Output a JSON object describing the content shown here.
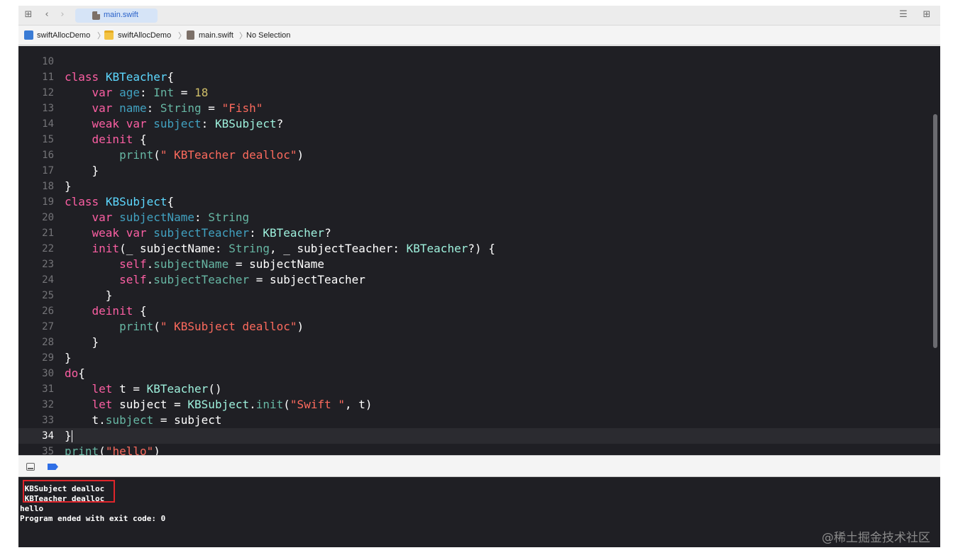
{
  "tab": {
    "title": "main.swift"
  },
  "breadcrumb": {
    "project": "swiftAllocDemo",
    "folder": "swiftAllocDemo",
    "file": "main.swift",
    "selection": "No Selection"
  },
  "editor": {
    "current_line": 34,
    "lines": [
      {
        "n": "10",
        "tokens": []
      },
      {
        "n": "11",
        "tokens": [
          [
            "kw",
            "class"
          ],
          [
            "pl",
            " "
          ],
          [
            "ty",
            "KBTeacher"
          ],
          [
            "pl",
            "{"
          ]
        ]
      },
      {
        "n": "12",
        "tokens": [
          [
            "pl",
            "    "
          ],
          [
            "kw",
            "var"
          ],
          [
            "pl",
            " "
          ],
          [
            "id",
            "age"
          ],
          [
            "pl",
            ": "
          ],
          [
            "ty2",
            "Int"
          ],
          [
            "pl",
            " = "
          ],
          [
            "nm",
            "18"
          ]
        ]
      },
      {
        "n": "13",
        "tokens": [
          [
            "pl",
            "    "
          ],
          [
            "kw",
            "var"
          ],
          [
            "pl",
            " "
          ],
          [
            "id",
            "name"
          ],
          [
            "pl",
            ": "
          ],
          [
            "ty2",
            "String"
          ],
          [
            "pl",
            " = "
          ],
          [
            "st",
            "\"Fish\""
          ]
        ]
      },
      {
        "n": "14",
        "tokens": [
          [
            "pl",
            "    "
          ],
          [
            "kw",
            "weak var"
          ],
          [
            "pl",
            " "
          ],
          [
            "id",
            "subject"
          ],
          [
            "pl",
            ": "
          ],
          [
            "cl",
            "KBSubject"
          ],
          [
            "pl",
            "?"
          ]
        ]
      },
      {
        "n": "15",
        "tokens": [
          [
            "pl",
            "    "
          ],
          [
            "kw",
            "deinit"
          ],
          [
            "pl",
            " {"
          ]
        ]
      },
      {
        "n": "16",
        "tokens": [
          [
            "pl",
            "        "
          ],
          [
            "pr",
            "print"
          ],
          [
            "pl",
            "("
          ],
          [
            "st",
            "\" KBTeacher dealloc\""
          ],
          [
            "pl",
            ")"
          ]
        ]
      },
      {
        "n": "17",
        "tokens": [
          [
            "pl",
            "    }"
          ]
        ]
      },
      {
        "n": "18",
        "tokens": [
          [
            "pl",
            "}"
          ]
        ]
      },
      {
        "n": "19",
        "tokens": [
          [
            "kw",
            "class"
          ],
          [
            "pl",
            " "
          ],
          [
            "ty",
            "KBSubject"
          ],
          [
            "pl",
            "{"
          ]
        ]
      },
      {
        "n": "20",
        "tokens": [
          [
            "pl",
            "    "
          ],
          [
            "kw",
            "var"
          ],
          [
            "pl",
            " "
          ],
          [
            "id",
            "subjectName"
          ],
          [
            "pl",
            ": "
          ],
          [
            "ty2",
            "String"
          ]
        ]
      },
      {
        "n": "21",
        "tokens": [
          [
            "pl",
            "    "
          ],
          [
            "kw",
            "weak var"
          ],
          [
            "pl",
            " "
          ],
          [
            "id",
            "subjectTeacher"
          ],
          [
            "pl",
            ": "
          ],
          [
            "cl",
            "KBTeacher"
          ],
          [
            "pl",
            "?"
          ]
        ]
      },
      {
        "n": "22",
        "tokens": [
          [
            "pl",
            "    "
          ],
          [
            "kw",
            "init"
          ],
          [
            "pl",
            "(_ subjectName: "
          ],
          [
            "ty2",
            "String"
          ],
          [
            "pl",
            ", _ subjectTeacher: "
          ],
          [
            "cl",
            "KBTeacher"
          ],
          [
            "pl",
            "?) {"
          ]
        ]
      },
      {
        "n": "23",
        "tokens": [
          [
            "pl",
            "        "
          ],
          [
            "kw",
            "self"
          ],
          [
            "pl",
            "."
          ],
          [
            "pr",
            "subjectName"
          ],
          [
            "pl",
            " = subjectName"
          ]
        ]
      },
      {
        "n": "24",
        "tokens": [
          [
            "pl",
            "        "
          ],
          [
            "kw",
            "self"
          ],
          [
            "pl",
            "."
          ],
          [
            "pr",
            "subjectTeacher"
          ],
          [
            "pl",
            " = subjectTeacher"
          ]
        ]
      },
      {
        "n": "25",
        "tokens": [
          [
            "pl",
            "      }"
          ]
        ]
      },
      {
        "n": "26",
        "tokens": [
          [
            "pl",
            "    "
          ],
          [
            "kw",
            "deinit"
          ],
          [
            "pl",
            " {"
          ]
        ]
      },
      {
        "n": "27",
        "tokens": [
          [
            "pl",
            "        "
          ],
          [
            "pr",
            "print"
          ],
          [
            "pl",
            "("
          ],
          [
            "st",
            "\" KBSubject dealloc\""
          ],
          [
            "pl",
            ")"
          ]
        ]
      },
      {
        "n": "28",
        "tokens": [
          [
            "pl",
            "    }"
          ]
        ]
      },
      {
        "n": "29",
        "tokens": [
          [
            "pl",
            "}"
          ]
        ]
      },
      {
        "n": "30",
        "tokens": [
          [
            "kw",
            "do"
          ],
          [
            "pl",
            "{"
          ]
        ]
      },
      {
        "n": "31",
        "tokens": [
          [
            "pl",
            "    "
          ],
          [
            "kw",
            "let"
          ],
          [
            "pl",
            " t = "
          ],
          [
            "cl",
            "KBTeacher"
          ],
          [
            "pl",
            "()"
          ]
        ]
      },
      {
        "n": "32",
        "tokens": [
          [
            "pl",
            "    "
          ],
          [
            "kw",
            "let"
          ],
          [
            "pl",
            " subject = "
          ],
          [
            "cl",
            "KBSubject"
          ],
          [
            "pl",
            "."
          ],
          [
            "pr",
            "init"
          ],
          [
            "pl",
            "("
          ],
          [
            "st",
            "\"Swift \""
          ],
          [
            "pl",
            ", t)"
          ]
        ]
      },
      {
        "n": "33",
        "tokens": [
          [
            "pl",
            "    t."
          ],
          [
            "pr",
            "subject"
          ],
          [
            "pl",
            " = subject"
          ]
        ]
      },
      {
        "n": "34",
        "tokens": [
          [
            "pl",
            "}"
          ]
        ]
      },
      {
        "n": "35",
        "tokens": [
          [
            "pr",
            "print"
          ],
          [
            "pl",
            "("
          ],
          [
            "st",
            "\"hello\""
          ],
          [
            "pl",
            ")"
          ]
        ]
      }
    ]
  },
  "console": {
    "lines": [
      " KBSubject dealloc",
      " KBTeacher dealloc",
      "hello",
      "Program ended with exit code: 0"
    ]
  },
  "watermark": "@稀土掘金技术社区",
  "colors": {
    "keyword": "#fc5fa3",
    "type": "#5dd8ff",
    "string": "#fc6a5d",
    "number": "#d0bf69",
    "highlight_box": "#e0252b"
  }
}
